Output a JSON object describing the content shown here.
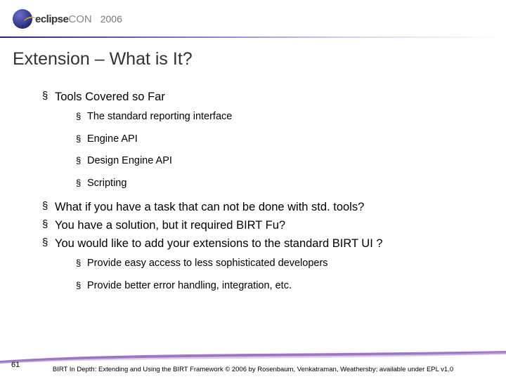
{
  "header": {
    "logo_bold": "eclipse",
    "logo_light": "CON",
    "year": "2006"
  },
  "title": "Extension – What is It?",
  "bullets": {
    "b1": "Tools Covered so Far",
    "b1_sub": [
      "The standard reporting interface",
      "Engine API",
      "Design Engine API",
      "Scripting"
    ],
    "b2": "What if you have a task that can not be done with std. tools?",
    "b3": "You have a solution, but it required BIRT Fu?",
    "b4": "You would like to add your extensions to the standard BIRT UI ?",
    "b4_sub": [
      "Provide easy access to less sophisticated developers",
      "Provide better error handling, integration, etc."
    ]
  },
  "footer": {
    "page": "61",
    "copyright": "BIRT In Depth: Extending and Using the BIRT Framework © 2006 by Rosenbaum, Venkatraman, Weathersby; available under EPL v1.0"
  }
}
